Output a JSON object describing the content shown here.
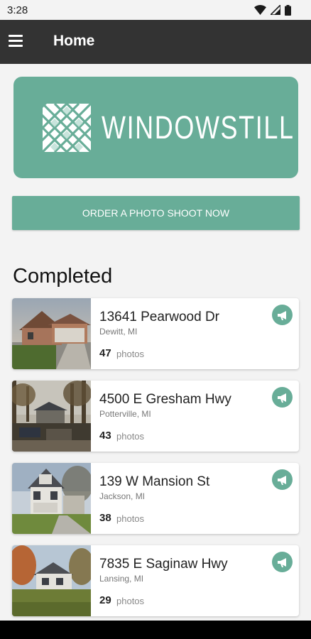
{
  "status_bar": {
    "time": "3:28",
    "icons": [
      "wifi-icon",
      "signal-icon",
      "battery-icon"
    ]
  },
  "app_bar": {
    "title": "Home",
    "menu_icon": "menu-icon"
  },
  "banner": {
    "logo_text": "WINDOWSTILL",
    "color": "#68ad98"
  },
  "order_button": {
    "label": "ORDER A PHOTO SHOOT NOW"
  },
  "completed": {
    "title": "Completed",
    "listings": [
      {
        "address": "13641 Pearwood Dr",
        "city": "Dewitt, MI",
        "photo_count": "47",
        "photos_label": "photos"
      },
      {
        "address": "4500 E Gresham Hwy",
        "city": "Potterville, MI",
        "photo_count": "43",
        "photos_label": "photos"
      },
      {
        "address": "139 W Mansion St",
        "city": "Jackson, MI",
        "photo_count": "38",
        "photos_label": "photos"
      },
      {
        "address": "7835 E Saginaw Hwy",
        "city": "Lansing, MI",
        "photo_count": "29",
        "photos_label": "photos"
      }
    ]
  },
  "colors": {
    "accent": "#68ad98",
    "app_bar": "#333333",
    "background": "#f3f3f3"
  }
}
